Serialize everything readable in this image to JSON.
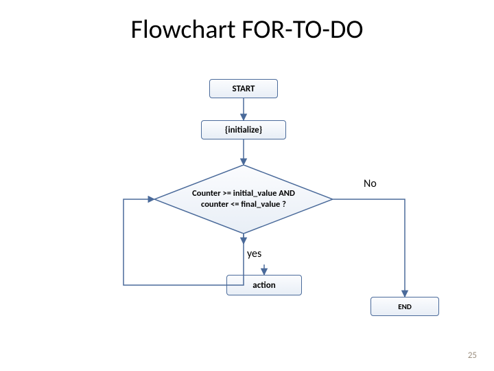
{
  "title": "Flowchart FOR-TO-DO",
  "slide_number": "25",
  "nodes": {
    "start": "START",
    "initialize": "{initialize}",
    "decision": "Counter >= initial_value AND counter <= final_value ?",
    "action": "action",
    "end": "END"
  },
  "edges": {
    "yes_label": "yes",
    "no_label": "No"
  },
  "colors": {
    "box_fill_top": "#fbfcfe",
    "box_fill_bottom": "#e8eef6",
    "box_border": "#4a6a9a",
    "arrow": "#4a6a9a"
  }
}
